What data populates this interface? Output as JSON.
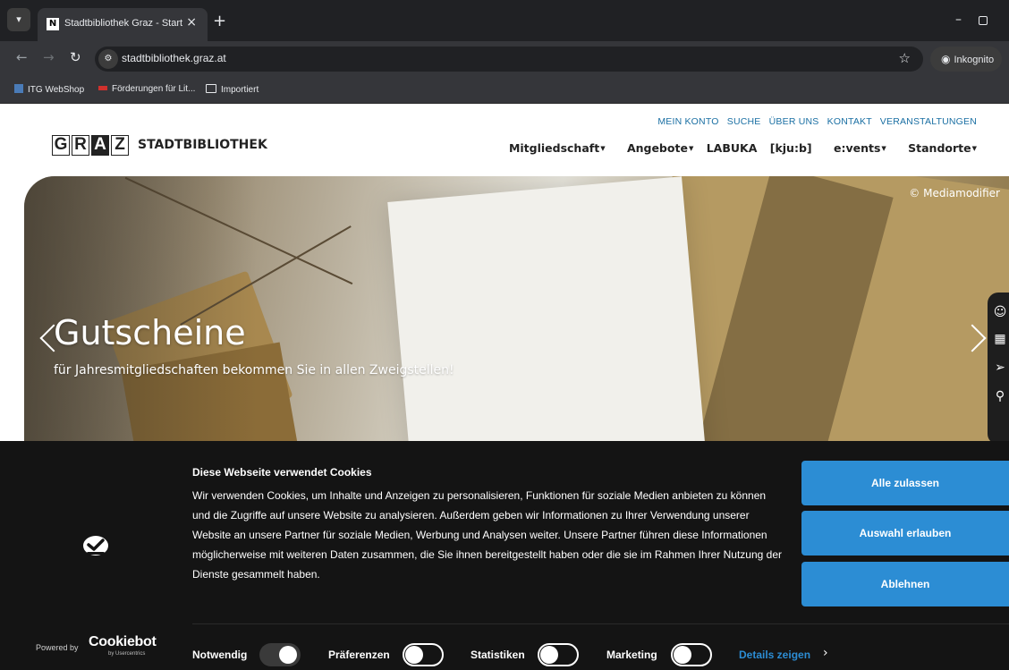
{
  "browser": {
    "tab_title": "Stadtbibliothek Graz - Start",
    "url": "stadtbibliothek.graz.at",
    "incognito_label": "Inkognito",
    "bookmarks": [
      "ITG WebShop",
      "Förderungen für Lit...",
      "Importiert"
    ]
  },
  "header": {
    "top_links": [
      "MEIN KONTO",
      "SUCHE",
      "ÜBER UNS",
      "KONTAKT",
      "VERANSTALTUNGEN"
    ],
    "logo_letters": [
      "G",
      "R",
      "A",
      "Z"
    ],
    "logo_name": "STADTBIBLIOTHEK",
    "main_nav": [
      "Mitgliedschaft",
      "Angebote",
      "LABUKA",
      "[kju:b]",
      "e:vents",
      "Standorte"
    ]
  },
  "hero": {
    "copyright": "© Mediamodifier",
    "title": "Gutscheine",
    "subtitle": "für Jahresmitgliedschaften bekommen Sie in allen Zweigstellen!"
  },
  "cookie_banner": {
    "title": "Diese Webseite verwendet Cookies",
    "text": "Wir verwenden Cookies, um Inhalte und Anzeigen zu personalisieren, Funktionen für soziale Medien anbieten zu können und die Zugriffe auf unsere Website zu analysieren. Außerdem geben wir Informationen zu Ihrer Verwendung unserer Website an unsere Partner für soziale Medien, Werbung und Analysen weiter. Unsere Partner führen diese Informationen möglicherweise mit weiteren Daten zusammen, die Sie ihnen bereitgestellt haben oder die sie im Rahmen Ihrer Nutzung der Dienste gesammelt haben.",
    "buttons": {
      "allow_all": "Alle zulassen",
      "allow_selection": "Auswahl erlauben",
      "deny": "Ablehnen"
    },
    "powered_by": "Powered by",
    "cookiebot_name": "Cookiebot",
    "usercentrics": "by Usercentrics",
    "toggles": [
      {
        "label": "Notwendig",
        "on": true
      },
      {
        "label": "Präferenzen",
        "on": false
      },
      {
        "label": "Statistiken",
        "on": false
      },
      {
        "label": "Marketing",
        "on": false
      }
    ],
    "details_label": "Details zeigen",
    "accent_color": "#2c8dd4"
  }
}
